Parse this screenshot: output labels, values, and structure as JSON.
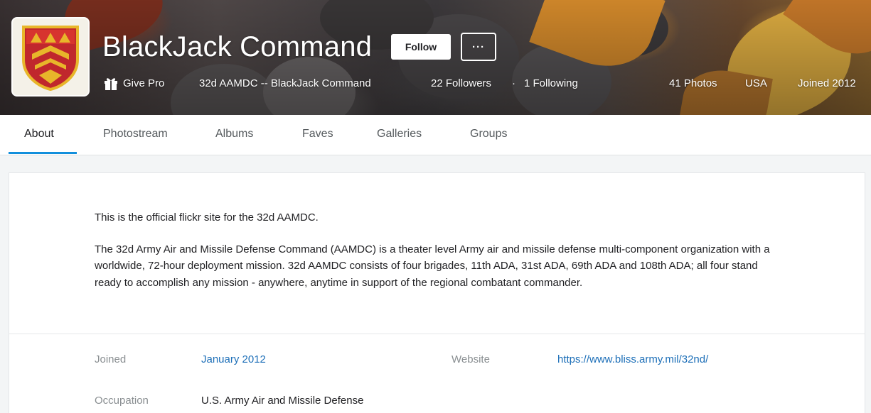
{
  "profile": {
    "name": "BlackJack Command",
    "follow_label": "Follow",
    "more_label": "···",
    "give_pro_label": "Give Pro",
    "real_name": "32d AAMDC -- BlackJack Command",
    "followers": "22 Followers",
    "separator": "·",
    "following": "1 Following",
    "photos": "41 Photos",
    "location": "USA",
    "joined": "Joined 2012"
  },
  "tabs": [
    {
      "label": "About",
      "active": true
    },
    {
      "label": "Photostream"
    },
    {
      "label": "Albums"
    },
    {
      "label": "Faves"
    },
    {
      "label": "Galleries"
    },
    {
      "label": "Groups"
    }
  ],
  "about": {
    "intro": "This is the official flickr site for the 32d AAMDC.",
    "description": "The 32d Army Air and Missile Defense Command (AAMDC) is a theater level Army air and missile defense multi-component organization with a worldwide, 72-hour deployment mission. 32d AAMDC consists of four brigades, 11th ADA, 31st ADA, 69th ADA and 108th ADA; all four stand ready to accomplish any mission - anywhere, anytime in support of the regional combatant commander.",
    "joined_label": "Joined",
    "joined_value": "January 2012",
    "website_label": "Website",
    "website_value": "https://www.bliss.army.mil/32nd/",
    "occupation_label": "Occupation",
    "occupation_value": "U.S. Army Air and Missile Defense"
  },
  "colors": {
    "accent": "#128fdc",
    "link": "#1d6fb8",
    "avatar_shield_red": "#c0272d",
    "avatar_shield_gold": "#e8b62a"
  },
  "icons": {
    "gift": "gift-icon",
    "avatar": "shield-insignia-icon"
  }
}
